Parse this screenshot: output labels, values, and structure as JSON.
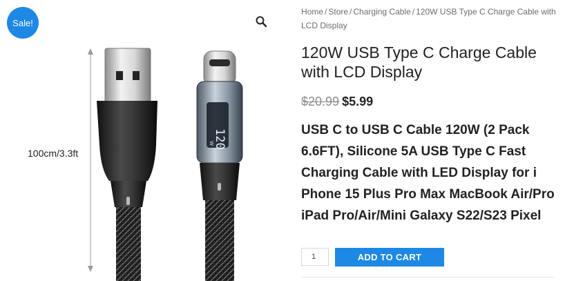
{
  "gallery": {
    "sale_badge": "Sale!",
    "zoom_icon": "search-icon",
    "dimension_label": "100cm/3.3ft",
    "lcd_reading": "120",
    "lcd_unit": "W",
    "colors": {
      "badge": "#1e88e5",
      "cable": "#1f1f1f"
    }
  },
  "breadcrumb": {
    "items": [
      "Home",
      "Store",
      "Charging Cable",
      "120W USB Type C Charge Cable with LCD Display"
    ],
    "separator": "/"
  },
  "product": {
    "title": "120W USB Type C Charge Cable with LCD Display",
    "price_old": "$20.99",
    "price_new": "$5.99",
    "short_description": "USB C to USB C Cable 120W (2 Pack 6.6FT), Silicone 5A USB Type C Fast Charging Cable with LED Display for i Phone 15 Plus Pro Max MacBook Air/Pro iPad Pro/Air/Mini Galaxy S22/S23 Pixel"
  },
  "cart": {
    "quantity": "1",
    "add_to_cart_label": "ADD TO CART",
    "button_color": "#1e88e5"
  }
}
